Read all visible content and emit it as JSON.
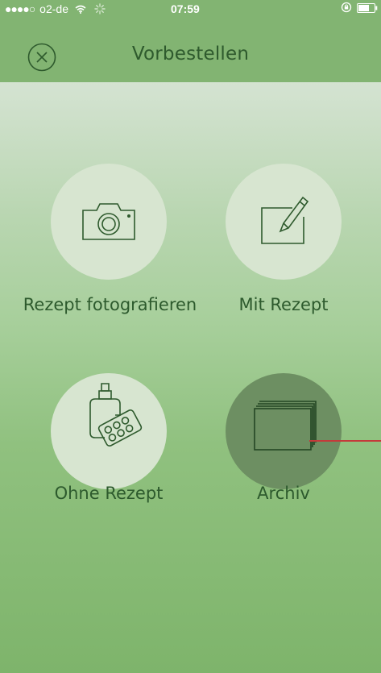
{
  "status_bar": {
    "signal": "●●●●○",
    "carrier": "o2-de",
    "time": "07:59"
  },
  "header": {
    "title": "Vorbestellen"
  },
  "menu": {
    "items": [
      {
        "label": "Rezept fotografieren",
        "icon": "camera-icon"
      },
      {
        "label": "Mit Rezept",
        "icon": "edit-icon"
      },
      {
        "label": "Ohne Rezept",
        "icon": "medicine-icon"
      },
      {
        "label": "Archiv",
        "icon": "archive-icon"
      }
    ]
  },
  "colors": {
    "header": "#82b472",
    "accent": "#2e5a2d",
    "circle": "#d7e5d0",
    "circle_active": "#6d8f62",
    "annotation_line": "#c43a3a"
  }
}
